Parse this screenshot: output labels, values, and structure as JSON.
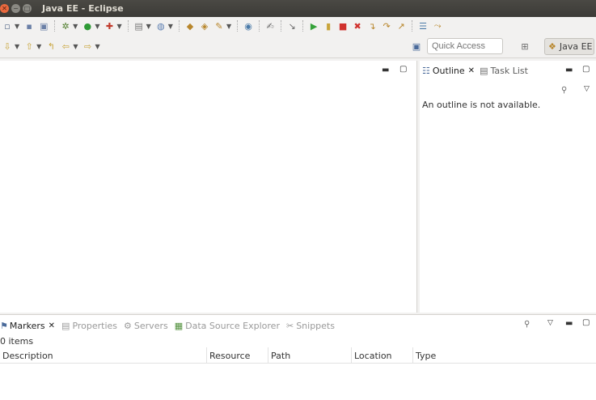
{
  "window": {
    "title": "Java EE - Eclipse"
  },
  "toolbar": {
    "quick_access_placeholder": "Quick Access",
    "perspective_label": "Java EE"
  },
  "outline": {
    "tabs": [
      {
        "label": "Outline"
      },
      {
        "label": "Task List"
      }
    ],
    "message": "An outline is not available."
  },
  "bottom": {
    "tabs": [
      {
        "label": "Markers"
      },
      {
        "label": "Properties"
      },
      {
        "label": "Servers"
      },
      {
        "label": "Data Source Explorer"
      },
      {
        "label": "Snippets"
      }
    ],
    "items_count": "0 items",
    "columns": [
      "Description",
      "Resource",
      "Path",
      "Location",
      "Type"
    ]
  }
}
